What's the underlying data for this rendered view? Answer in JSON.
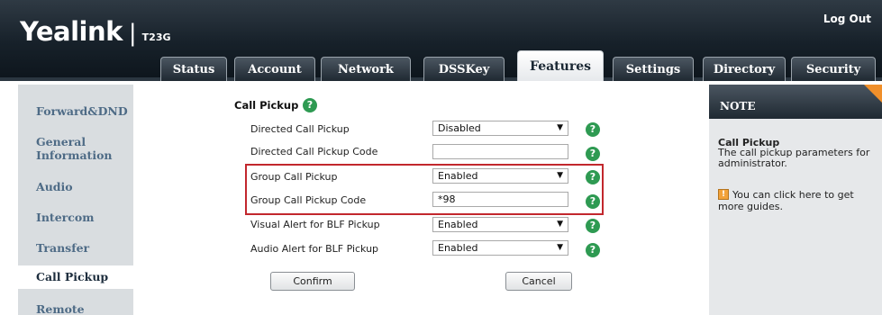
{
  "header": {
    "logo_main": "Yealink",
    "logo_model": "T23G",
    "logout_label": "Log Out"
  },
  "tabs": [
    {
      "label": "Status"
    },
    {
      "label": "Account"
    },
    {
      "label": "Network"
    },
    {
      "label": "DSSKey"
    },
    {
      "label": "Features",
      "active": true
    },
    {
      "label": "Settings"
    },
    {
      "label": "Directory"
    },
    {
      "label": "Security"
    }
  ],
  "sidebar": {
    "items": [
      {
        "label": "Forward&DND"
      },
      {
        "label": "General\nInformation"
      },
      {
        "label": "Audio"
      },
      {
        "label": "Intercom"
      },
      {
        "label": "Transfer"
      },
      {
        "label": "Call Pickup",
        "active": true
      },
      {
        "label": "Remote Control"
      }
    ]
  },
  "main": {
    "section_title": "Call Pickup",
    "rows": [
      {
        "label": "Directed Call Pickup",
        "value": "Disabled",
        "type": "select"
      },
      {
        "label": "Directed Call Pickup Code",
        "value": "",
        "type": "text"
      },
      {
        "label": "Group Call Pickup",
        "value": "Enabled",
        "type": "select"
      },
      {
        "label": "Group Call Pickup Code",
        "value": "*98",
        "type": "text"
      },
      {
        "label": "Visual Alert for BLF Pickup",
        "value": "Enabled",
        "type": "select"
      },
      {
        "label": "Audio Alert for BLF Pickup",
        "value": "Enabled",
        "type": "select"
      }
    ],
    "confirm_label": "Confirm",
    "cancel_label": "Cancel"
  },
  "note": {
    "header": "NOTE",
    "title": "Call Pickup",
    "text": "The call pickup parameters for administrator.",
    "guide_text": "You can click here to get more guides."
  },
  "colors": {
    "header_dark": "#17212a",
    "nav_text": "#4e6b86",
    "help_green": "#2e9a52",
    "highlight_red": "#c2272d",
    "note_corner": "#f08f2a"
  }
}
